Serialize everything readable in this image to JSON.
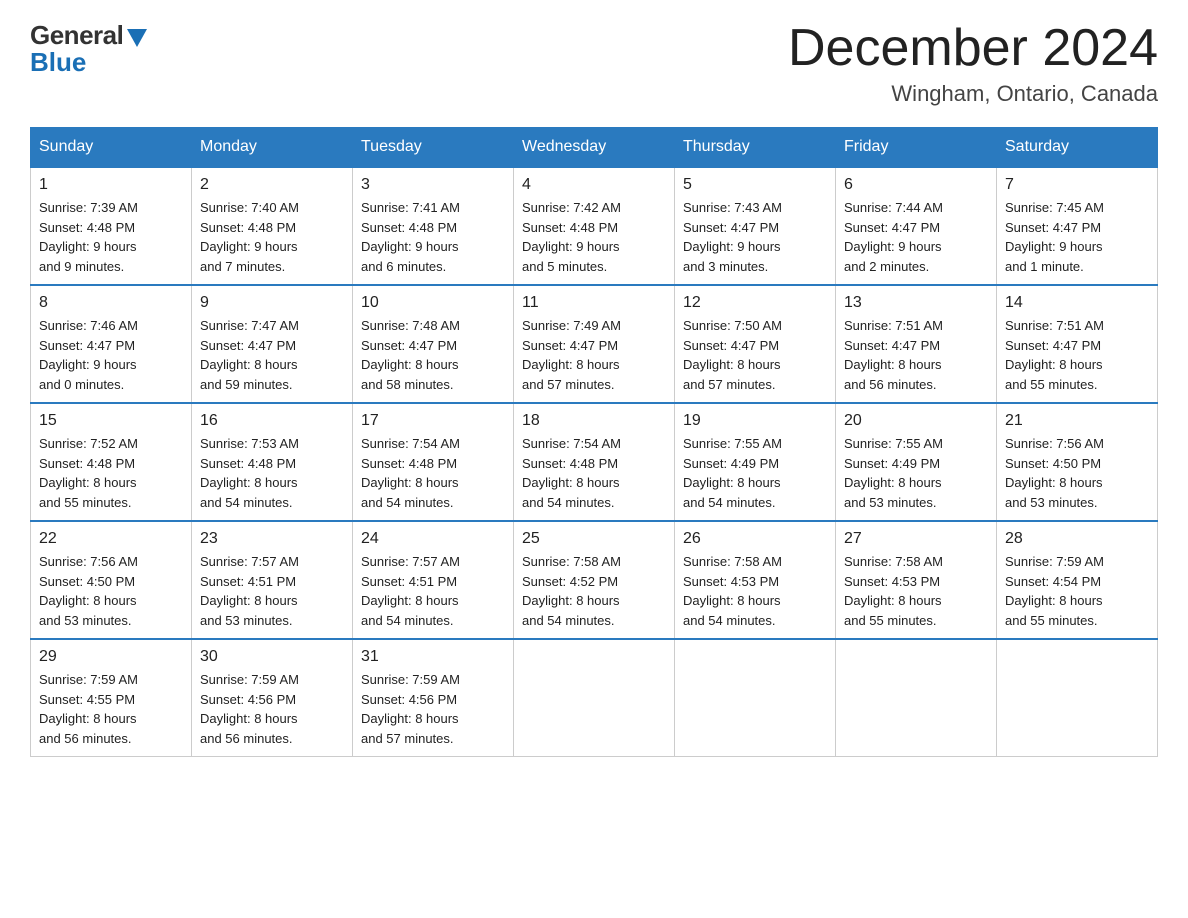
{
  "header": {
    "logo_general": "General",
    "logo_blue": "Blue",
    "month_title": "December 2024",
    "location": "Wingham, Ontario, Canada"
  },
  "weekdays": [
    "Sunday",
    "Monday",
    "Tuesday",
    "Wednesday",
    "Thursday",
    "Friday",
    "Saturday"
  ],
  "weeks": [
    [
      {
        "day": "1",
        "info": "Sunrise: 7:39 AM\nSunset: 4:48 PM\nDaylight: 9 hours\nand 9 minutes."
      },
      {
        "day": "2",
        "info": "Sunrise: 7:40 AM\nSunset: 4:48 PM\nDaylight: 9 hours\nand 7 minutes."
      },
      {
        "day": "3",
        "info": "Sunrise: 7:41 AM\nSunset: 4:48 PM\nDaylight: 9 hours\nand 6 minutes."
      },
      {
        "day": "4",
        "info": "Sunrise: 7:42 AM\nSunset: 4:48 PM\nDaylight: 9 hours\nand 5 minutes."
      },
      {
        "day": "5",
        "info": "Sunrise: 7:43 AM\nSunset: 4:47 PM\nDaylight: 9 hours\nand 3 minutes."
      },
      {
        "day": "6",
        "info": "Sunrise: 7:44 AM\nSunset: 4:47 PM\nDaylight: 9 hours\nand 2 minutes."
      },
      {
        "day": "7",
        "info": "Sunrise: 7:45 AM\nSunset: 4:47 PM\nDaylight: 9 hours\nand 1 minute."
      }
    ],
    [
      {
        "day": "8",
        "info": "Sunrise: 7:46 AM\nSunset: 4:47 PM\nDaylight: 9 hours\nand 0 minutes."
      },
      {
        "day": "9",
        "info": "Sunrise: 7:47 AM\nSunset: 4:47 PM\nDaylight: 8 hours\nand 59 minutes."
      },
      {
        "day": "10",
        "info": "Sunrise: 7:48 AM\nSunset: 4:47 PM\nDaylight: 8 hours\nand 58 minutes."
      },
      {
        "day": "11",
        "info": "Sunrise: 7:49 AM\nSunset: 4:47 PM\nDaylight: 8 hours\nand 57 minutes."
      },
      {
        "day": "12",
        "info": "Sunrise: 7:50 AM\nSunset: 4:47 PM\nDaylight: 8 hours\nand 57 minutes."
      },
      {
        "day": "13",
        "info": "Sunrise: 7:51 AM\nSunset: 4:47 PM\nDaylight: 8 hours\nand 56 minutes."
      },
      {
        "day": "14",
        "info": "Sunrise: 7:51 AM\nSunset: 4:47 PM\nDaylight: 8 hours\nand 55 minutes."
      }
    ],
    [
      {
        "day": "15",
        "info": "Sunrise: 7:52 AM\nSunset: 4:48 PM\nDaylight: 8 hours\nand 55 minutes."
      },
      {
        "day": "16",
        "info": "Sunrise: 7:53 AM\nSunset: 4:48 PM\nDaylight: 8 hours\nand 54 minutes."
      },
      {
        "day": "17",
        "info": "Sunrise: 7:54 AM\nSunset: 4:48 PM\nDaylight: 8 hours\nand 54 minutes."
      },
      {
        "day": "18",
        "info": "Sunrise: 7:54 AM\nSunset: 4:48 PM\nDaylight: 8 hours\nand 54 minutes."
      },
      {
        "day": "19",
        "info": "Sunrise: 7:55 AM\nSunset: 4:49 PM\nDaylight: 8 hours\nand 54 minutes."
      },
      {
        "day": "20",
        "info": "Sunrise: 7:55 AM\nSunset: 4:49 PM\nDaylight: 8 hours\nand 53 minutes."
      },
      {
        "day": "21",
        "info": "Sunrise: 7:56 AM\nSunset: 4:50 PM\nDaylight: 8 hours\nand 53 minutes."
      }
    ],
    [
      {
        "day": "22",
        "info": "Sunrise: 7:56 AM\nSunset: 4:50 PM\nDaylight: 8 hours\nand 53 minutes."
      },
      {
        "day": "23",
        "info": "Sunrise: 7:57 AM\nSunset: 4:51 PM\nDaylight: 8 hours\nand 53 minutes."
      },
      {
        "day": "24",
        "info": "Sunrise: 7:57 AM\nSunset: 4:51 PM\nDaylight: 8 hours\nand 54 minutes."
      },
      {
        "day": "25",
        "info": "Sunrise: 7:58 AM\nSunset: 4:52 PM\nDaylight: 8 hours\nand 54 minutes."
      },
      {
        "day": "26",
        "info": "Sunrise: 7:58 AM\nSunset: 4:53 PM\nDaylight: 8 hours\nand 54 minutes."
      },
      {
        "day": "27",
        "info": "Sunrise: 7:58 AM\nSunset: 4:53 PM\nDaylight: 8 hours\nand 55 minutes."
      },
      {
        "day": "28",
        "info": "Sunrise: 7:59 AM\nSunset: 4:54 PM\nDaylight: 8 hours\nand 55 minutes."
      }
    ],
    [
      {
        "day": "29",
        "info": "Sunrise: 7:59 AM\nSunset: 4:55 PM\nDaylight: 8 hours\nand 56 minutes."
      },
      {
        "day": "30",
        "info": "Sunrise: 7:59 AM\nSunset: 4:56 PM\nDaylight: 8 hours\nand 56 minutes."
      },
      {
        "day": "31",
        "info": "Sunrise: 7:59 AM\nSunset: 4:56 PM\nDaylight: 8 hours\nand 57 minutes."
      },
      {
        "day": "",
        "info": ""
      },
      {
        "day": "",
        "info": ""
      },
      {
        "day": "",
        "info": ""
      },
      {
        "day": "",
        "info": ""
      }
    ]
  ]
}
